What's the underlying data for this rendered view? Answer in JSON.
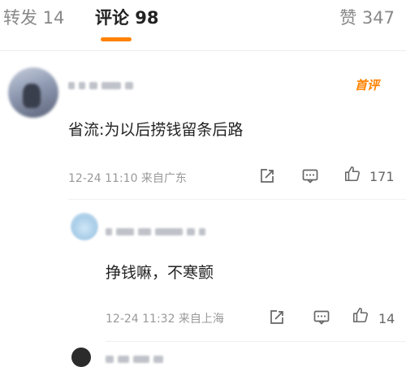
{
  "tabs": [
    {
      "label": "转发 14"
    },
    {
      "label": "评论 98"
    },
    {
      "label": "赞 347"
    }
  ],
  "comment": {
    "badge": "首评",
    "text": "省流:为以后捞钱留条后路",
    "meta": "12-24 11:10 来自广东",
    "like_count": "171"
  },
  "reply": {
    "text": "挣钱嘛，不寒颤",
    "meta": "12-24 11:32 来自上海",
    "like_count": "14"
  },
  "colors": {
    "accent": "#ff8200",
    "muted": "#999999"
  },
  "icons": [
    "share-icon",
    "comment-icon",
    "like-icon"
  ]
}
